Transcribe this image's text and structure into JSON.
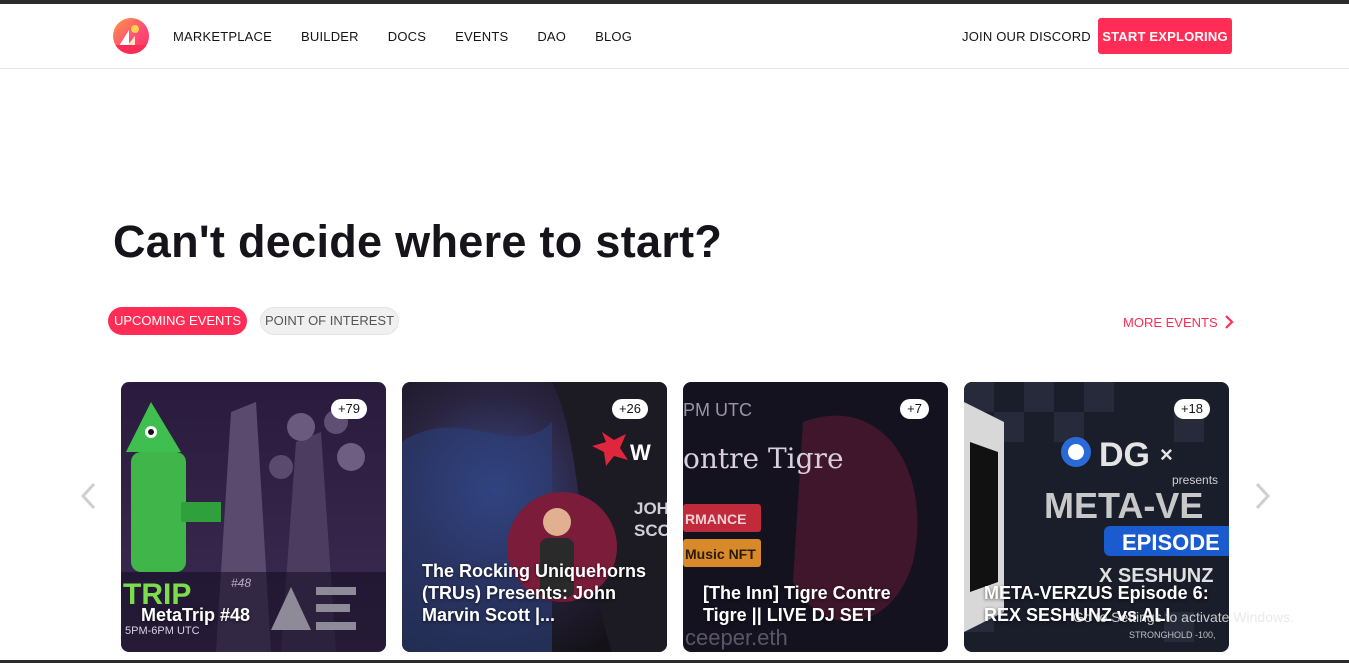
{
  "nav": {
    "links": [
      "MARKETPLACE",
      "BUILDER",
      "DOCS",
      "EVENTS",
      "DAO",
      "BLOG"
    ],
    "discord_label": "JOIN OUR DISCORD",
    "cta_label": "START EXPLORING"
  },
  "hero": {
    "headline": "Can't decide where to start?"
  },
  "filters": {
    "active": "UPCOMING EVENTS",
    "inactive": "POINT OF INTEREST"
  },
  "more_events_label": "MORE EVENTS",
  "cards": [
    {
      "title": "MetaTrip #48",
      "badge": "+79",
      "art_text_1": "TRIP",
      "art_text_2": "5PM-6PM UTC",
      "art_text_3": "#48"
    },
    {
      "title": "The Rocking Uniquehorns (TRUs) Presents: John Marvin Scott |...",
      "badge": "+26",
      "art_text_1": "JOH",
      "art_text_2": "SCO"
    },
    {
      "title": "[The Inn] Tigre Contre Tigre || LIVE DJ SET",
      "badge": "+7",
      "art_text_1": "PM UTC",
      "art_text_2": "ontre Tigre",
      "art_text_3": "RMANCE",
      "art_text_4": "Music NFT",
      "art_text_5": "ceeper.eth"
    },
    {
      "title": "META-VERZUS Episode 6: REX SESHUNZ vs ALI",
      "badge": "+18",
      "art_text_1": "DG",
      "art_text_2": "presents",
      "art_text_3": "META-VE",
      "art_text_4": "EPISODE",
      "art_text_5": "X SESHUNZ",
      "art_text_6": "STRONGHOLD -100,"
    }
  ],
  "watermark": "Go to Settings to activate Windows.",
  "colors": {
    "accent": "#ff2d55",
    "text": "#16141a"
  },
  "icons": {
    "logo": "decentraland-logo",
    "more": "chevron-right-icon",
    "prev": "chevron-left-icon",
    "next": "chevron-right-icon"
  }
}
